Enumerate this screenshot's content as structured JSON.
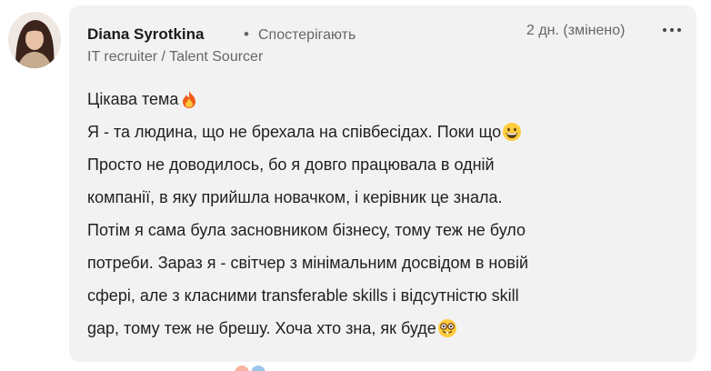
{
  "comment": {
    "author": {
      "name": "Diana Syrotkina",
      "separator": "•",
      "follow_status": "Спостерігають",
      "headline": "IT recruiter / Talent Sourcer"
    },
    "timestamp": "2 дн. (змінено)",
    "more_icon": "more-horizontal-icon",
    "lines": [
      "Цікава тема",
      "Я - та людина, що не брехала на співбесідах. Поки що",
      "Просто не доводилось, бо я довго працювала в одній",
      "компанії, в яку прийшла новачком, і керівник це знала.",
      "Потім я сама була засновником бізнесу, тому теж не було",
      "потреби. Зараз я - світчер з мінімальним досвідом в новій",
      "сфері, але з класними transferable skills і відсутністю skill",
      "gap, тому теж не брешу. Хоча хто зна, як буде"
    ],
    "emojis": {
      "line1": "fire-emoji",
      "line2": "grinning-face-emoji",
      "line8": "nerd-face-emoji"
    }
  },
  "colors": {
    "card_background": "#f2f2f2",
    "text_primary": "#1f1f1f",
    "text_secondary": "#666666"
  }
}
